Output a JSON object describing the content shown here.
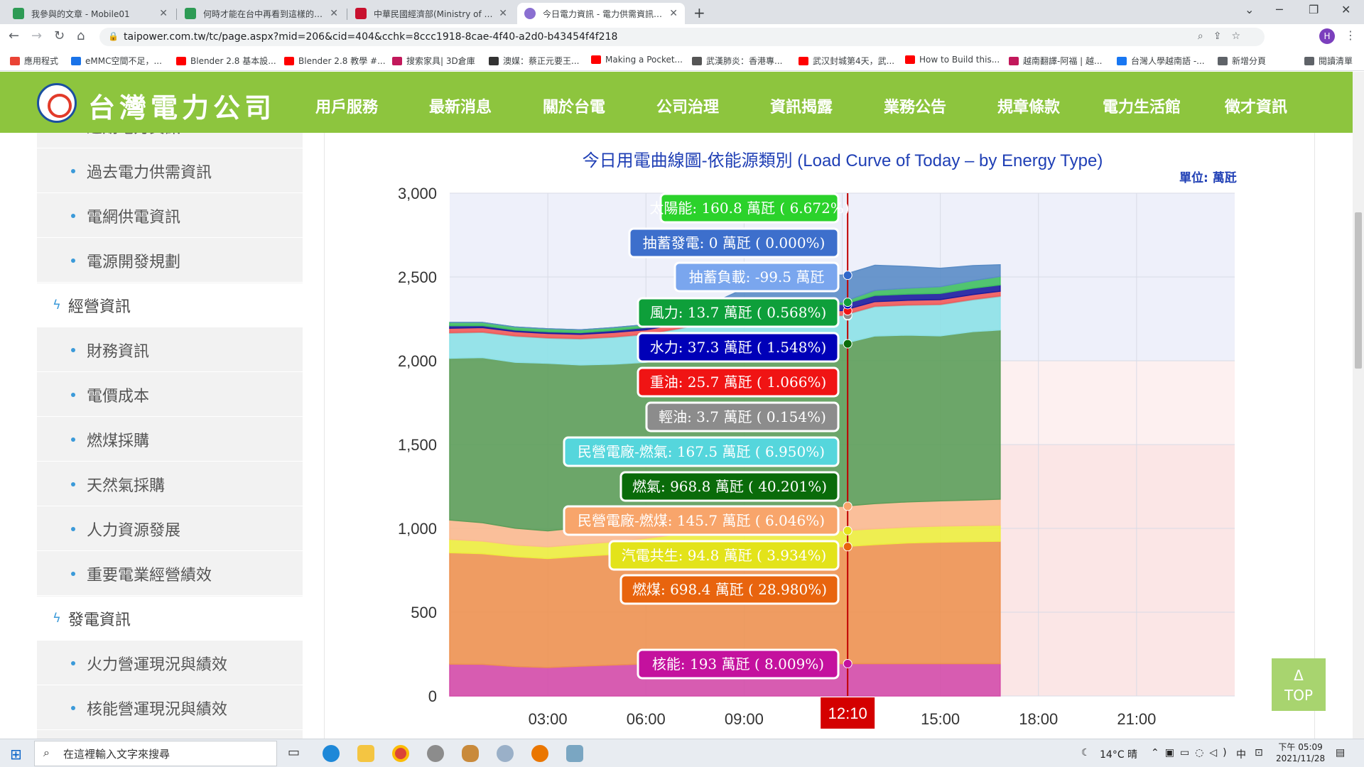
{
  "browser": {
    "tabs": [
      {
        "title": "我參與的文章 - Mobile01",
        "color": "#2e9b55"
      },
      {
        "title": "何時才能在台中再看到這樣的藍天",
        "color": "#2e9b55"
      },
      {
        "title": "中華民國經濟部(Ministry of Eco",
        "color": "#c8102e"
      },
      {
        "title": "今日電力資訊 - 電力供需資訊 - 台",
        "color": "#8a6fd1"
      }
    ],
    "url": "taipower.com.tw/tc/page.aspx?mid=206&cid=404&cchk=8ccc1918-8cae-4f40-a2d0-b43454f4f218",
    "profile_initial": "H",
    "bookmarks": [
      {
        "label": "應用程式",
        "color": "#ea4335"
      },
      {
        "label": "eMMC空間不足，...",
        "color": "#1a73e8"
      },
      {
        "label": "Blender 2.8 基本設...",
        "color": "#ff0000"
      },
      {
        "label": "Blender 2.8 教學 #...",
        "color": "#ff0000"
      },
      {
        "label": "搜索家具| 3D倉庫",
        "color": "#c2185b"
      },
      {
        "label": "澳媒：蔡正元要王...",
        "color": "#333333"
      },
      {
        "label": "Making a Pocket...",
        "color": "#ff0000"
      },
      {
        "label": "武漢肺炎：香港專...",
        "color": "#555555"
      },
      {
        "label": "武汉封城第4天，武...",
        "color": "#ff0000"
      },
      {
        "label": "How to Build this...",
        "color": "#ff0000"
      },
      {
        "label": "越南翻譯-阿福 | 越...",
        "color": "#c2185b"
      },
      {
        "label": "台灣人學越南語 -...",
        "color": "#1877f2"
      },
      {
        "label": "新增分頁",
        "color": "#5f6368"
      },
      {
        "label": "閱讀清單",
        "color": "#5f6368"
      }
    ]
  },
  "site": {
    "logo_text": "台灣電力公司",
    "nav": [
      "用戶服務",
      "最新消息",
      "關於台電",
      "公司治理",
      "資訊揭露",
      "業務公告",
      "規章條款",
      "電力生活館",
      "徵才資訊"
    ],
    "active_nav": "資訊揭露"
  },
  "sidebar": {
    "items": [
      {
        "label": "近期電力資訊",
        "type": "sub"
      },
      {
        "label": "過去電力供需資訊",
        "type": "sub"
      },
      {
        "label": "電網供電資訊",
        "type": "sub"
      },
      {
        "label": "電源開發規劃",
        "type": "sub"
      },
      {
        "label": "經營資訊",
        "type": "cat"
      },
      {
        "label": "財務資訊",
        "type": "sub"
      },
      {
        "label": "電價成本",
        "type": "sub"
      },
      {
        "label": "燃煤採購",
        "type": "sub"
      },
      {
        "label": "天然氣採購",
        "type": "sub"
      },
      {
        "label": "人力資源發展",
        "type": "sub"
      },
      {
        "label": "重要電業經營績效",
        "type": "sub"
      },
      {
        "label": "發電資訊",
        "type": "cat"
      },
      {
        "label": "火力營運現況與績效",
        "type": "sub"
      },
      {
        "label": "核能營運現況與績效",
        "type": "sub"
      }
    ]
  },
  "chart_title": "今日用電曲線圖-依能源類別 (Load Curve of Today – by Energy Type)",
  "unit_label": "單位: 萬瓩",
  "top_button": {
    "arrow": "Δ",
    "label": "TOP"
  },
  "taskbar": {
    "search_placeholder": "在這裡輸入文字來搜尋",
    "weather": "14°C 晴",
    "ime": "中",
    "time": "下午 05:09",
    "date": "2021/11/28"
  },
  "chart_data": {
    "type": "area",
    "title": "今日用電曲線圖-依能源類別 (Load Curve of Today – by Energy Type)",
    "unit": "萬瓩",
    "ylim": [
      0,
      3000
    ],
    "yticks": [
      0,
      500,
      1000,
      1500,
      2000,
      2500,
      3000
    ],
    "xticks": [
      "03:00",
      "06:00",
      "09:00",
      "12:10",
      "15:00",
      "18:00",
      "21:00"
    ],
    "xlim_hours": [
      0,
      24
    ],
    "data_end_hour": 16.83,
    "cursor": "12:10",
    "x_hours": [
      0,
      1,
      2,
      3,
      4,
      5,
      6,
      7,
      8,
      9,
      10,
      11,
      12,
      13,
      14,
      15,
      16,
      16.83
    ],
    "series": [
      {
        "name": "核能",
        "color": "#d44ba8",
        "values": [
          190,
          189,
          176,
          170,
          178,
          185,
          191,
          190,
          189,
          190,
          192,
          193,
          193,
          193,
          193,
          193,
          193,
          193
        ]
      },
      {
        "name": "燃煤",
        "color": "#ee9251",
        "values": [
          665,
          660,
          655,
          650,
          655,
          660,
          670,
          690,
          700,
          700,
          698,
          698,
          698,
          710,
          720,
          725,
          728,
          730
        ]
      },
      {
        "name": "汽電共生",
        "color": "#eded3e",
        "values": [
          80,
          75,
          70,
          70,
          72,
          75,
          80,
          85,
          90,
          93,
          94,
          95,
          95,
          95,
          95,
          96,
          96,
          96
        ]
      },
      {
        "name": "民營電廠-燃煤",
        "color": "#fbb98f",
        "values": [
          115,
          110,
          100,
          95,
          100,
          110,
          120,
          130,
          140,
          145,
          145,
          146,
          146,
          150,
          150,
          150,
          152,
          155
        ]
      },
      {
        "name": "燃氣",
        "color": "#5d9d59",
        "values": [
          965,
          985,
          990,
          1000,
          970,
          950,
          930,
          920,
          940,
          955,
          965,
          970,
          969,
          1000,
          995,
          985,
          1005,
          1010
        ]
      },
      {
        "name": "民營電廠-燃氣",
        "color": "#8ce1e7",
        "values": [
          150,
          150,
          155,
          150,
          155,
          160,
          165,
          175,
          170,
          168,
          168,
          168,
          168,
          175,
          178,
          185,
          190,
          200
        ]
      },
      {
        "name": "輕油",
        "color": "#a6a6a6",
        "values": [
          4,
          4,
          4,
          4,
          4,
          4,
          4,
          4,
          4,
          4,
          4,
          4,
          4,
          4,
          4,
          4,
          4,
          4
        ]
      },
      {
        "name": "重油",
        "color": "#f15a5a",
        "values": [
          25,
          25,
          24,
          24,
          24,
          25,
          25,
          25,
          25,
          26,
          26,
          26,
          26,
          26,
          26,
          27,
          27,
          27
        ]
      },
      {
        "name": "水力",
        "color": "#1c1c9e",
        "values": [
          15,
          12,
          10,
          10,
          10,
          12,
          14,
          20,
          28,
          35,
          37,
          37,
          37,
          37,
          37,
          37,
          38,
          38
        ]
      },
      {
        "name": "風力",
        "color": "#3fbf61",
        "values": [
          20,
          19,
          18,
          18,
          17,
          17,
          16,
          15,
          15,
          14,
          14,
          14,
          14,
          30,
          35,
          40,
          45,
          50
        ]
      },
      {
        "name": "太陽能",
        "color": "#5a8cc6",
        "values": [
          0,
          0,
          0,
          0,
          0,
          0,
          0,
          5,
          40,
          100,
          145,
          160,
          161,
          150,
          130,
          110,
          90,
          70
        ]
      }
    ],
    "tooltips": [
      {
        "text": "太陽能: 160.8 萬瓩 ( 6.672%)",
        "bg": "#2bd22b"
      },
      {
        "text": "抽蓄發電: 0 萬瓩 ( 0.000%)",
        "bg": "#3d6fcc"
      },
      {
        "text": "抽蓄負載: -99.5 萬瓩",
        "bg": "#7aa6ee"
      },
      {
        "text": "風力: 13.7 萬瓩 ( 0.568%)",
        "bg": "#0e9f3a"
      },
      {
        "text": "水力: 37.3 萬瓩 ( 1.548%)",
        "bg": "#0000b8"
      },
      {
        "text": "重油: 25.7 萬瓩 ( 1.066%)",
        "bg": "#f01414"
      },
      {
        "text": "輕油: 3.7 萬瓩 ( 0.154%)",
        "bg": "#8c8c8c"
      },
      {
        "text": "民營電廠-燃氣: 167.5 萬瓩 ( 6.950%)",
        "bg": "#55d6dc"
      },
      {
        "text": "燃氣: 968.8 萬瓩 ( 40.201%)",
        "bg": "#0a6b0a"
      },
      {
        "text": "民營電廠-燃煤: 145.7 萬瓩 ( 6.046%)",
        "bg": "#f8a56b"
      },
      {
        "text": "汽電共生: 94.8 萬瓩 ( 3.934%)",
        "bg": "#e3e31a"
      },
      {
        "text": "燃煤: 698.4 萬瓩 ( 28.980%)",
        "bg": "#e8640e"
      },
      {
        "text": "核能: 193 萬瓩 ( 8.009%)",
        "bg": "#c4119e"
      }
    ]
  }
}
